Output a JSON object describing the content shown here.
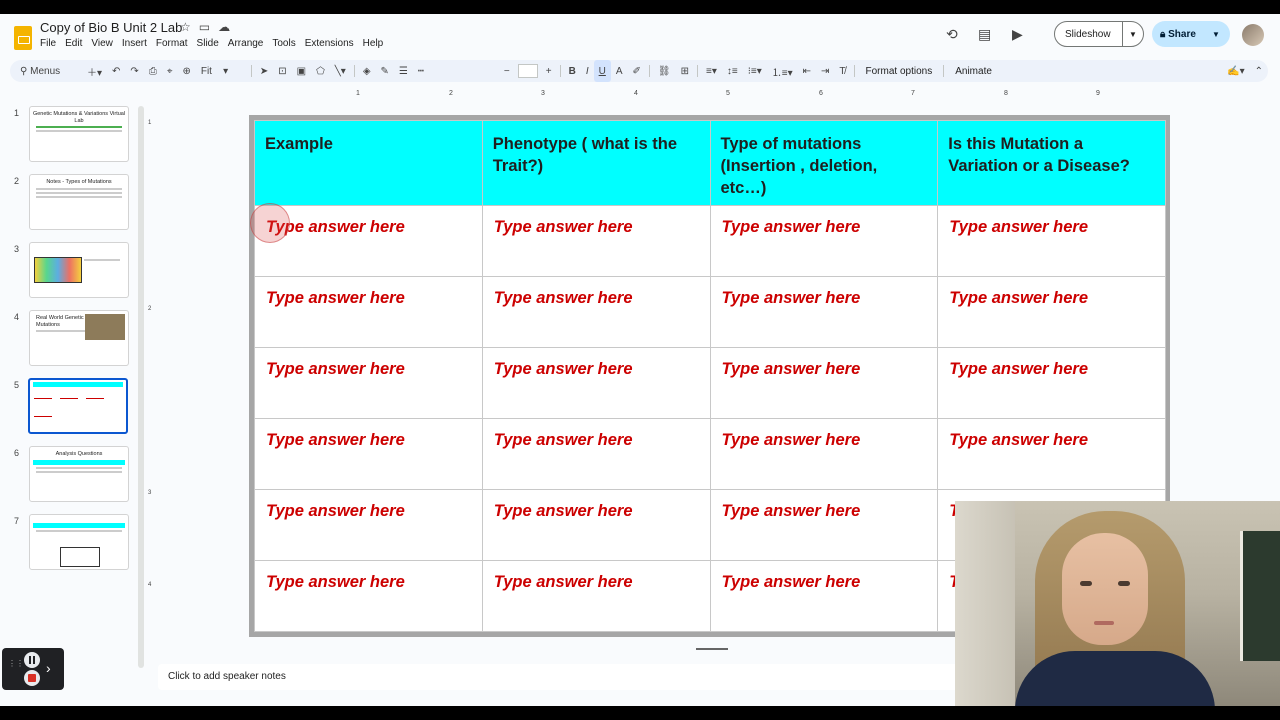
{
  "doc": {
    "title": "Copy of Bio B Unit 2 Lab"
  },
  "menu": [
    "File",
    "Edit",
    "View",
    "Insert",
    "Format",
    "Slide",
    "Arrange",
    "Tools",
    "Extensions",
    "Help"
  ],
  "header": {
    "slideshow_label": "Slideshow",
    "share_label": "Share"
  },
  "toolbar": {
    "menus_label": "Menus",
    "zoom_label": "Fit",
    "format_options": "Format options",
    "animate": "Animate"
  },
  "ruler": {
    "h": [
      "1",
      "2",
      "3",
      "4",
      "5",
      "6",
      "7",
      "8",
      "9"
    ],
    "v": [
      "1",
      "2",
      "3",
      "4"
    ]
  },
  "slides": [
    {
      "num": "1",
      "title": "Genetic Mutations & Variations Virtual Lab"
    },
    {
      "num": "2",
      "title": "Notes - Types of Mutations"
    },
    {
      "num": "3",
      "title": ""
    },
    {
      "num": "4",
      "title": "Real World Genetic Mutations"
    },
    {
      "num": "5",
      "title": ""
    },
    {
      "num": "6",
      "title": "Analysis Questions"
    },
    {
      "num": "7",
      "title": ""
    }
  ],
  "table": {
    "headers": [
      "Example",
      "Phenotype ( what is the Trait?)",
      "Type of mutations (Insertion , deletion, etc…)",
      "Is this Mutation a Variation or a Disease?"
    ],
    "placeholder": "Type answer here",
    "colors": {
      "header_bg": "#00ffff",
      "answer_text": "#cc0000"
    }
  },
  "notes": {
    "placeholder": "Click to add speaker notes"
  }
}
